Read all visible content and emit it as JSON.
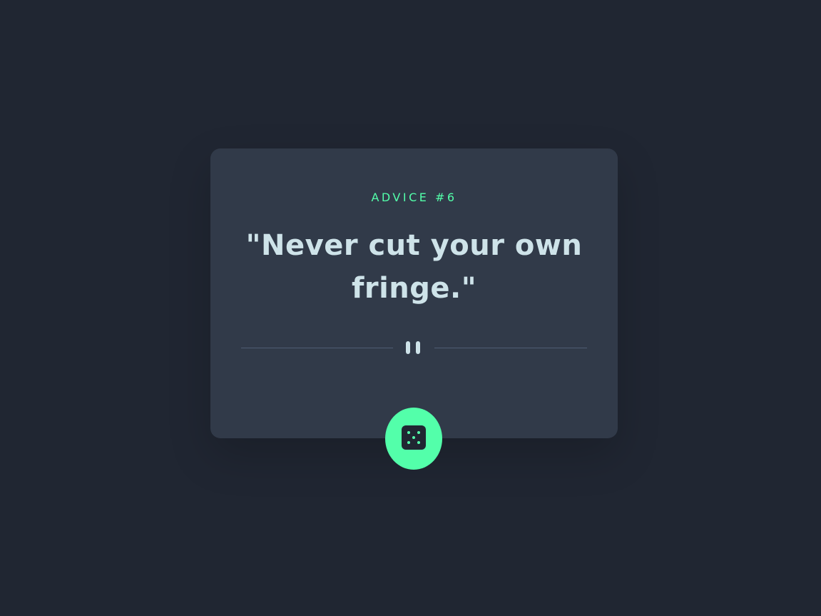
{
  "advice": {
    "id_label": "ADVICE #6",
    "quote": "\"Never cut your own fringe.\""
  },
  "divider": {
    "icon": "pause-icon"
  },
  "dice_button": {
    "icon": "dice-icon"
  },
  "colors": {
    "background": "#202632",
    "card": "#313a49",
    "accent": "#53ffaa",
    "text": "#cee3e9",
    "divider": "#4f5d74"
  }
}
